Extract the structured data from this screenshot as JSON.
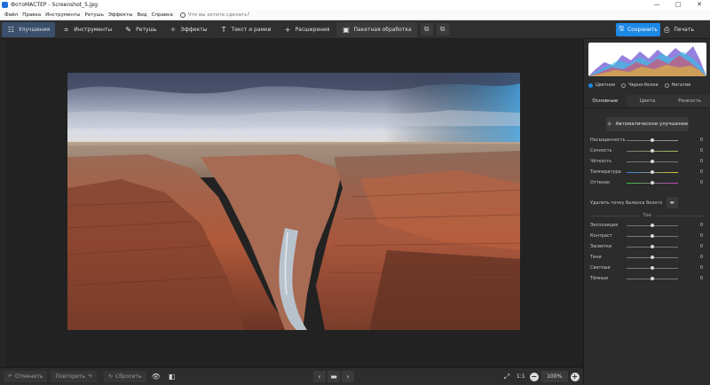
{
  "window": {
    "title": "ФотоМАСТЕР - Screenshot_5.jpg",
    "controls": [
      "—",
      "□",
      "✕"
    ]
  },
  "menu": {
    "items": [
      "Файл",
      "Правка",
      "Инструменты",
      "Ретушь",
      "Эффекты",
      "Вид",
      "Справка"
    ],
    "search_placeholder": "Что вы хотите сделать?"
  },
  "toolbar": {
    "tabs": [
      {
        "label": "Улучшения",
        "icon": "sliders-icon",
        "active": true
      },
      {
        "label": "Инструменты",
        "icon": "crop-icon",
        "active": false
      },
      {
        "label": "Ретушь",
        "icon": "brush-icon",
        "active": false
      },
      {
        "label": "Эффекты",
        "icon": "magic-wand-icon",
        "active": false
      },
      {
        "label": "Текст и рамки",
        "icon": "text-icon",
        "active": false
      },
      {
        "label": "Расширения",
        "icon": "plus-icon",
        "active": false
      },
      {
        "label": "Пакетная обработка",
        "icon": "batch-icon",
        "active": false
      }
    ],
    "save_label": "Сохранить",
    "print_label": "Печать"
  },
  "bottom": {
    "undo_label": "Отменить",
    "redo_label": "Повторить",
    "reset_label": "Сбросить",
    "ratio_label": "1:1",
    "zoom": "100%"
  },
  "panel": {
    "modes": [
      {
        "label": "Цветное",
        "selected": true
      },
      {
        "label": "Черно-белое",
        "selected": false
      },
      {
        "label": "Негатив",
        "selected": false
      }
    ],
    "tabs": [
      {
        "label": "Основные",
        "active": true
      },
      {
        "label": "Цвета",
        "active": false
      },
      {
        "label": "Резкость",
        "active": false
      }
    ],
    "auto_label": "Автоматическое улучшение",
    "color_sliders": [
      {
        "label": "Насыщенность",
        "value": "0"
      },
      {
        "label": "Сочность",
        "value": "0"
      },
      {
        "label": "Чёткость",
        "value": "0"
      },
      {
        "label": "Температура",
        "value": "0"
      },
      {
        "label": "Оттенок",
        "value": "0"
      }
    ],
    "haze_label": "Удалить точку баланса белого",
    "tone_label": "Тон",
    "tone_sliders": [
      {
        "label": "Экспозиция",
        "value": "0"
      },
      {
        "label": "Контраст",
        "value": "0"
      },
      {
        "label": "Засветки",
        "value": "0"
      },
      {
        "label": "Тени",
        "value": "0"
      },
      {
        "label": "Светлые",
        "value": "0"
      },
      {
        "label": "Тёмные",
        "value": "0"
      }
    ]
  },
  "colors": {
    "accent": "#1e88e5",
    "active_tab": "#3a4f6c"
  }
}
